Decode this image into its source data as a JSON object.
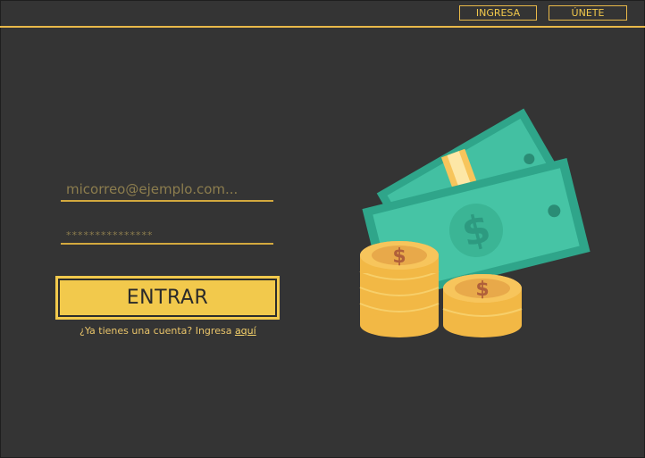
{
  "nav": {
    "login_label": "INGRESA",
    "signup_label": "ÚNETE"
  },
  "form": {
    "email_placeholder": "micorreo@ejemplo.com...",
    "password_placeholder": "***************",
    "submit_label": "ENTRAR",
    "account_prompt": "¿Ya tienes una cuenta? Ingresa ",
    "account_link": "aquí"
  },
  "illustration": {
    "icon": "money-illustration",
    "bill_symbol": "$",
    "coin_symbol": "$"
  },
  "colors": {
    "background": "#343434",
    "accent": "#f2c94c",
    "bill": "#45c3a3",
    "coin": "#f7c55c"
  }
}
